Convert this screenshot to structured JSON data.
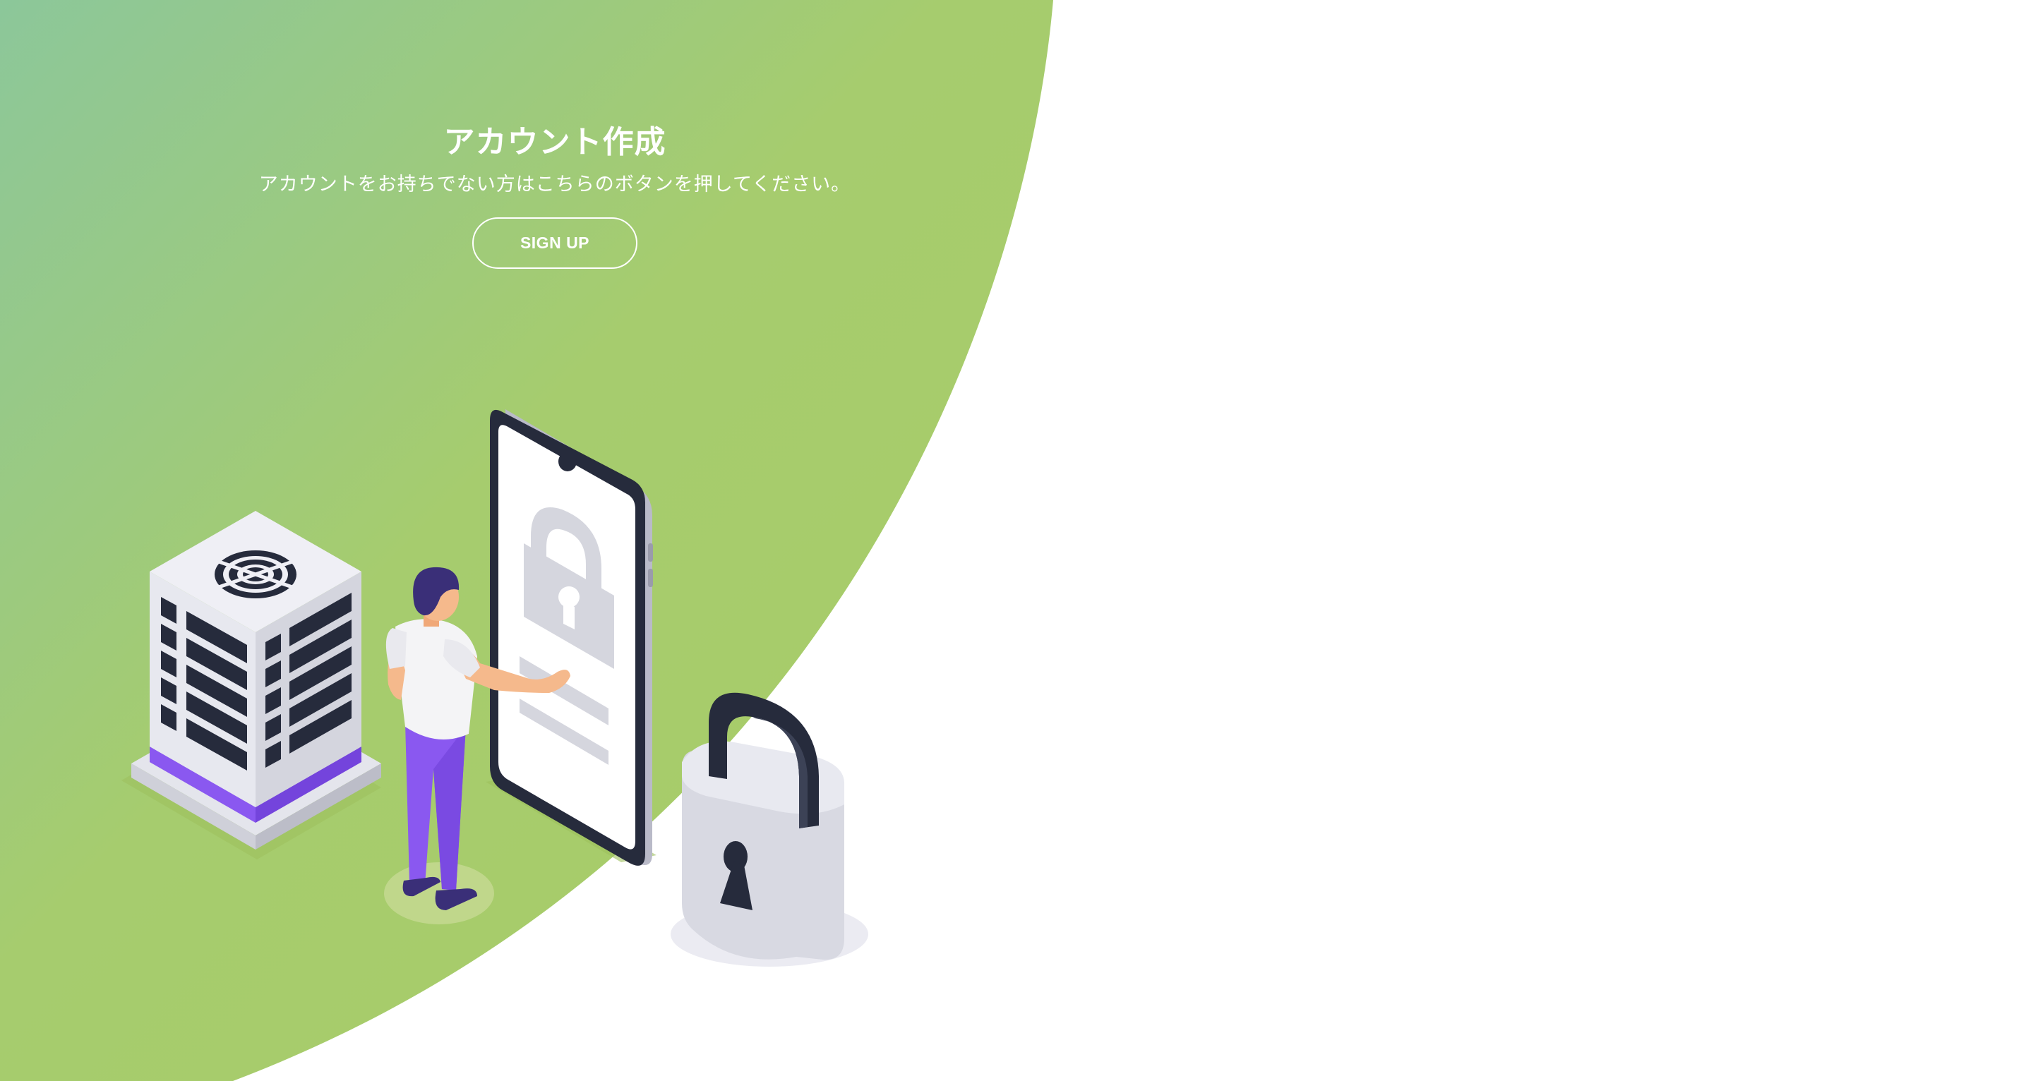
{
  "signup_panel": {
    "title": "アカウント作成",
    "description": "アカウントをお持ちでない方はこちらのボタンを押してください。",
    "button_label": "SIGN UP"
  },
  "colors": {
    "gradient_start": "#8cc79a",
    "gradient_end": "#a9cd66",
    "accent_purple": "#8a58f0",
    "dark_navy": "#262b3c",
    "light_gray": "#d5d6de",
    "white": "#ffffff"
  },
  "illustration": {
    "elements": [
      "server-rack",
      "person",
      "smartphone",
      "padlock"
    ],
    "icons": [
      "lock-icon",
      "keyhole-icon",
      "fan-grill-icon"
    ]
  }
}
